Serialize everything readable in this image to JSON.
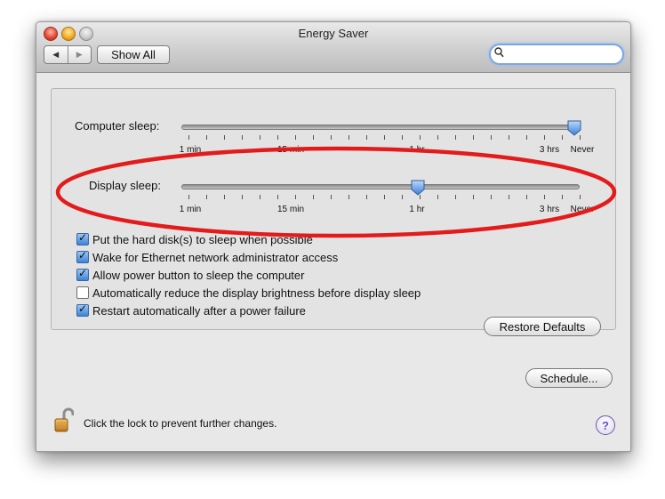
{
  "window": {
    "title": "Energy Saver",
    "back_symbol": "◀",
    "forward_symbol": "▶",
    "show_all_label": "Show All",
    "search": {
      "icon": "magnifier-icon",
      "value": "",
      "placeholder": ""
    }
  },
  "sliders": {
    "tick_labels": [
      "1 min",
      "15 min",
      "1 hr",
      "3 hrs",
      "Never"
    ],
    "computer_sleep": {
      "label": "Computer sleep:",
      "value": "Never"
    },
    "display_sleep": {
      "label": "Display sleep:",
      "value": "1 hr"
    }
  },
  "options": [
    {
      "label": "Put the hard disk(s) to sleep when possible",
      "checked": true
    },
    {
      "label": "Wake for Ethernet network administrator access",
      "checked": true
    },
    {
      "label": "Allow power button to sleep the computer",
      "checked": true
    },
    {
      "label": "Automatically reduce the display brightness before display sleep",
      "checked": false
    },
    {
      "label": "Restart automatically after a power failure",
      "checked": true
    }
  ],
  "buttons": {
    "restore_defaults": "Restore Defaults",
    "schedule": "Schedule..."
  },
  "footer": {
    "lock_text": "Click the lock to prevent further changes.",
    "help_symbol": "?"
  },
  "colors": {
    "annotation": "#e31b1b",
    "focus_ring": "#7aa7e6",
    "knob": "#4f8fdc"
  }
}
